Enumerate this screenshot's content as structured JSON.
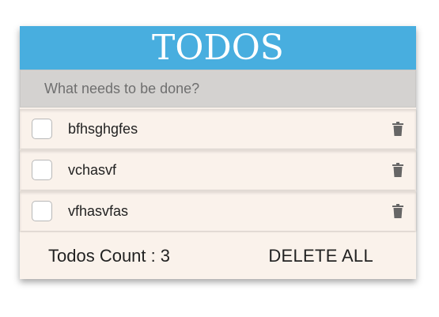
{
  "header": {
    "title": "TODOS"
  },
  "new_todo": {
    "placeholder": "What needs to be done?",
    "value": ""
  },
  "todos": [
    {
      "text": "bfhsghgfes",
      "done": false
    },
    {
      "text": "vchasvf",
      "done": false
    },
    {
      "text": "vfhasvfas",
      "done": false
    }
  ],
  "footer": {
    "count_label": "Todos Count :",
    "count_value": "3",
    "delete_all_label": "DELETE ALL"
  },
  "colors": {
    "header_bg": "#48aedf",
    "input_bg": "#d4d2d0",
    "item_bg": "#faf2eb",
    "icon_gray": "#666666"
  },
  "icons": {
    "delete": "trash-icon"
  }
}
